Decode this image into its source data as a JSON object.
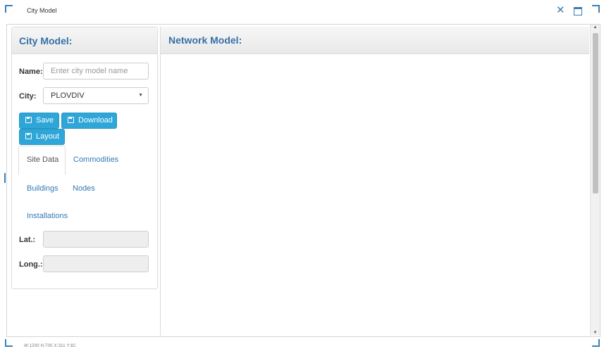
{
  "window": {
    "title": "City Model",
    "close_icon": "close-icon",
    "maximize_icon": "maximize-icon"
  },
  "left_panel": {
    "heading": "City Model:",
    "name_label": "Name:",
    "name_placeholder": "Enter city model name",
    "name_value": "",
    "city_label": "City:",
    "city_value": "PLOVDIV",
    "buttons": {
      "save": "Save",
      "download": "Download",
      "layout": "Layout"
    },
    "tabs": {
      "site_data": "Site Data",
      "commodities": "Commodities",
      "buildings": "Buildings",
      "nodes": "Nodes",
      "installations": "Installations",
      "active": "Site Data"
    },
    "lat_label": "Lat.:",
    "lat_value": "",
    "long_label": "Long.:",
    "long_value": ""
  },
  "right_panel": {
    "heading": "Network Model:"
  },
  "status_bar": {
    "text": "W:1200   H:700   X:311   Y:82"
  },
  "colors": {
    "accent": "#2ea6d8",
    "heading": "#3570a7",
    "link": "#337ab7",
    "frame": "#3b7fb6"
  }
}
